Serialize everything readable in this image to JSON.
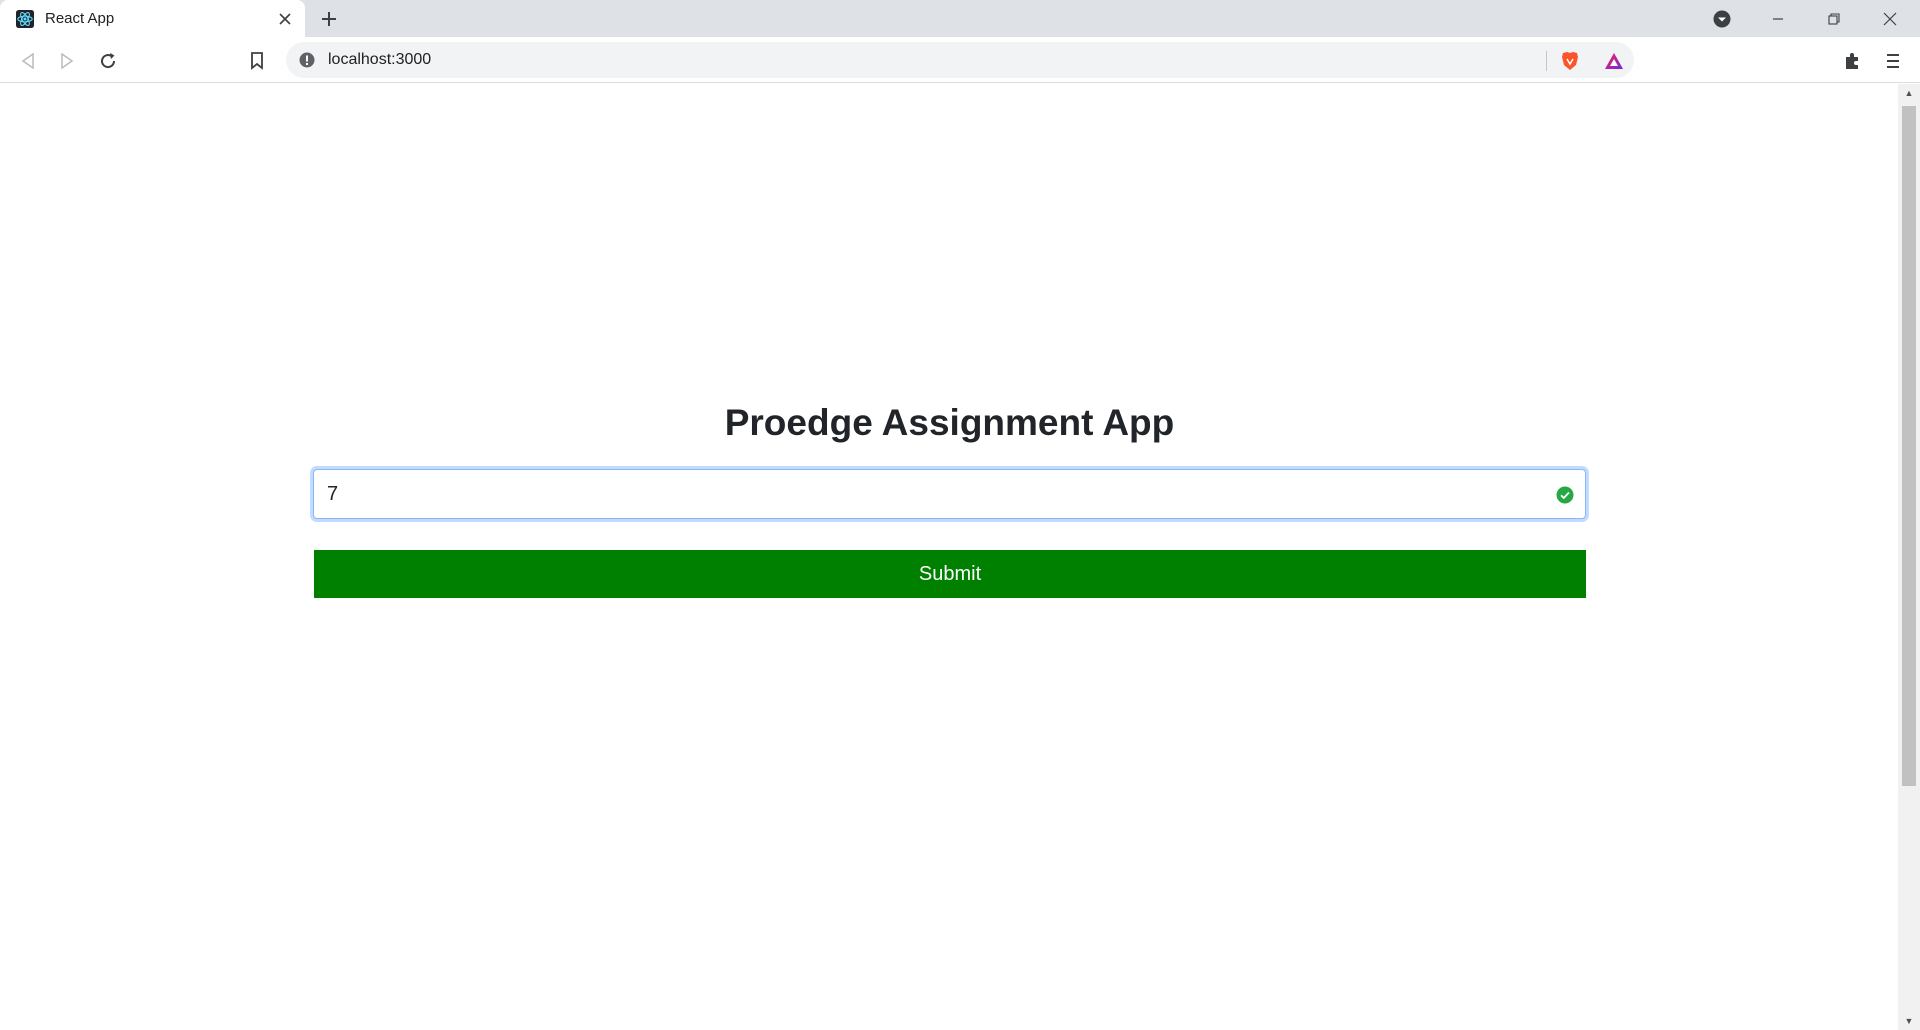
{
  "browser": {
    "tab_title": "React App",
    "url": "localhost:3000",
    "icons": {
      "favicon": "react-icon",
      "tab_close": "close-icon",
      "new_tab": "plus-icon",
      "back": "back-arrow-icon",
      "forward": "forward-arrow-icon",
      "reload": "reload-icon",
      "bookmark": "bookmark-icon",
      "site_info": "info-icon",
      "brave_shields": "brave-lion-icon",
      "brave_rewards": "triangle-icon",
      "extensions": "puzzle-icon",
      "menu": "hamburger-menu-icon"
    }
  },
  "page": {
    "title": "Proedge Assignment App",
    "input_value": "7",
    "submit_label": "Submit"
  },
  "colors": {
    "submit_bg": "#008000",
    "valid_green": "#28a745",
    "focus_border": "#86b7fe"
  }
}
